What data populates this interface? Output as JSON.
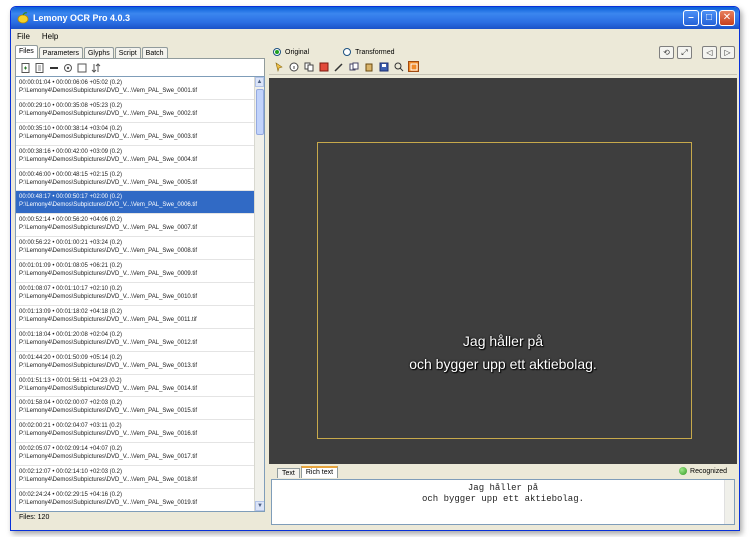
{
  "window": {
    "title": "Lemony OCR Pro 4.0.3"
  },
  "menu": [
    "File",
    "Help"
  ],
  "left_tabs": [
    {
      "label": "Files",
      "active": true
    },
    {
      "label": "Parameters",
      "active": false
    },
    {
      "label": "Glyphs",
      "active": false
    },
    {
      "label": "Script",
      "active": false
    },
    {
      "label": "Batch",
      "active": false
    }
  ],
  "left_toolbar_icons": [
    "add-file-icon",
    "open-folder-icon",
    "remove-icon",
    "settings-icon",
    "select-icon",
    "sort-icon"
  ],
  "files": [
    {
      "line1": "00:00:01:04 • 00:00:06:06  +05:02  (0.2)",
      "line2": "P:\\Lemony4\\Demos\\Subpictures\\DVD_V...\\Vem_PAL_Swe_0001.tif",
      "selected": false
    },
    {
      "line1": "00:00:29:10 • 00:00:35:08  +05:23  (0.2)",
      "line2": "P:\\Lemony4\\Demos\\Subpictures\\DVD_V...\\Vem_PAL_Swe_0002.tif",
      "selected": false
    },
    {
      "line1": "00:00:35:10 • 00:00:38:14  +03:04  (0.2)",
      "line2": "P:\\Lemony4\\Demos\\Subpictures\\DVD_V...\\Vem_PAL_Swe_0003.tif",
      "selected": false
    },
    {
      "line1": "00:00:38:16 • 00:00:42:00  +03:09  (0.2)",
      "line2": "P:\\Lemony4\\Demos\\Subpictures\\DVD_V...\\Vem_PAL_Swe_0004.tif",
      "selected": false
    },
    {
      "line1": "00:00:46:00 • 00:00:48:15  +02:15  (0.2)",
      "line2": "P:\\Lemony4\\Demos\\Subpictures\\DVD_V...\\Vem_PAL_Swe_0005.tif",
      "selected": false
    },
    {
      "line1": "00:00:48:17 • 00:00:50:17  +02:00  (0.2)",
      "line2": "P:\\Lemony4\\Demos\\Subpictures\\DVD_V...\\Vem_PAL_Swe_0006.tif",
      "selected": true
    },
    {
      "line1": "00:00:52:14 • 00:00:56:20  +04:06  (0.2)",
      "line2": "P:\\Lemony4\\Demos\\Subpictures\\DVD_V...\\Vem_PAL_Swe_0007.tif",
      "selected": false
    },
    {
      "line1": "00:00:56:22 • 00:01:00:21  +03:24  (0.2)",
      "line2": "P:\\Lemony4\\Demos\\Subpictures\\DVD_V...\\Vem_PAL_Swe_0008.tif",
      "selected": false
    },
    {
      "line1": "00:01:01:09 • 00:01:08:05  +06:21  (0.2)",
      "line2": "P:\\Lemony4\\Demos\\Subpictures\\DVD_V...\\Vem_PAL_Swe_0009.tif",
      "selected": false
    },
    {
      "line1": "00:01:08:07 • 00:01:10:17  +02:10  (0.2)",
      "line2": "P:\\Lemony4\\Demos\\Subpictures\\DVD_V...\\Vem_PAL_Swe_0010.tif",
      "selected": false
    },
    {
      "line1": "00:01:13:09 • 00:01:18:02  +04:18  (0.2)",
      "line2": "P:\\Lemony4\\Demos\\Subpictures\\DVD_V...\\Vem_PAL_Swe_0011.tif",
      "selected": false
    },
    {
      "line1": "00:01:18:04 • 00:01:20:08  +02:04  (0.2)",
      "line2": "P:\\Lemony4\\Demos\\Subpictures\\DVD_V...\\Vem_PAL_Swe_0012.tif",
      "selected": false
    },
    {
      "line1": "00:01:44:20 • 00:01:50:09  +05:14  (0.2)",
      "line2": "P:\\Lemony4\\Demos\\Subpictures\\DVD_V...\\Vem_PAL_Swe_0013.tif",
      "selected": false
    },
    {
      "line1": "00:01:51:13 • 00:01:56:11  +04:23  (0.2)",
      "line2": "P:\\Lemony4\\Demos\\Subpictures\\DVD_V...\\Vem_PAL_Swe_0014.tif",
      "selected": false
    },
    {
      "line1": "00:01:58:04 • 00:02:00:07  +02:03  (0.2)",
      "line2": "P:\\Lemony4\\Demos\\Subpictures\\DVD_V...\\Vem_PAL_Swe_0015.tif",
      "selected": false
    },
    {
      "line1": "00:02:00:21 • 00:02:04:07  +03:11  (0.2)",
      "line2": "P:\\Lemony4\\Demos\\Subpictures\\DVD_V...\\Vem_PAL_Swe_0016.tif",
      "selected": false
    },
    {
      "line1": "00:02:05:07 • 00:02:09:14  +04:07  (0.2)",
      "line2": "P:\\Lemony4\\Demos\\Subpictures\\DVD_V...\\Vem_PAL_Swe_0017.tif",
      "selected": false
    },
    {
      "line1": "00:02:12:07 • 00:02:14:10  +02:03  (0.2)",
      "line2": "P:\\Lemony4\\Demos\\Subpictures\\DVD_V...\\Vem_PAL_Swe_0018.tif",
      "selected": false
    },
    {
      "line1": "00:02:24:24 • 00:02:29:15  +04:16  (0.2)",
      "line2": "P:\\Lemony4\\Demos\\Subpictures\\DVD_V...\\Vem_PAL_Swe_0019.tif",
      "selected": false
    }
  ],
  "status": "Files: 120",
  "view_mode": {
    "original_label": "Original",
    "transformed_label": "Transformed",
    "selected": "Original"
  },
  "right_toolbar_icons": [
    "pointer-icon",
    "info-icon",
    "copy-icon",
    "crop-icon",
    "pen-icon",
    "copy-all-icon",
    "paste-icon",
    "save-icon",
    "search-icon",
    "highlight-icon"
  ],
  "nav_icons": [
    "rotate-left-icon",
    "zoom-icon",
    "prev-icon",
    "next-icon"
  ],
  "preview_subtitle": [
    "Jag håller på",
    "och bygger upp ett aktiebolag."
  ],
  "bottom_tabs": [
    {
      "label": "Text",
      "active": false
    },
    {
      "label": "Rich text",
      "active": true
    }
  ],
  "recognized_label": "Recognized",
  "recognized_text": [
    "Jag håller på",
    "och bygger upp ett aktiebolag."
  ],
  "colors": {
    "titlebar": "#2a6ee3",
    "selection": "#316ac5",
    "viewer": "#3e3e3e",
    "frame": "#c7a94b"
  }
}
